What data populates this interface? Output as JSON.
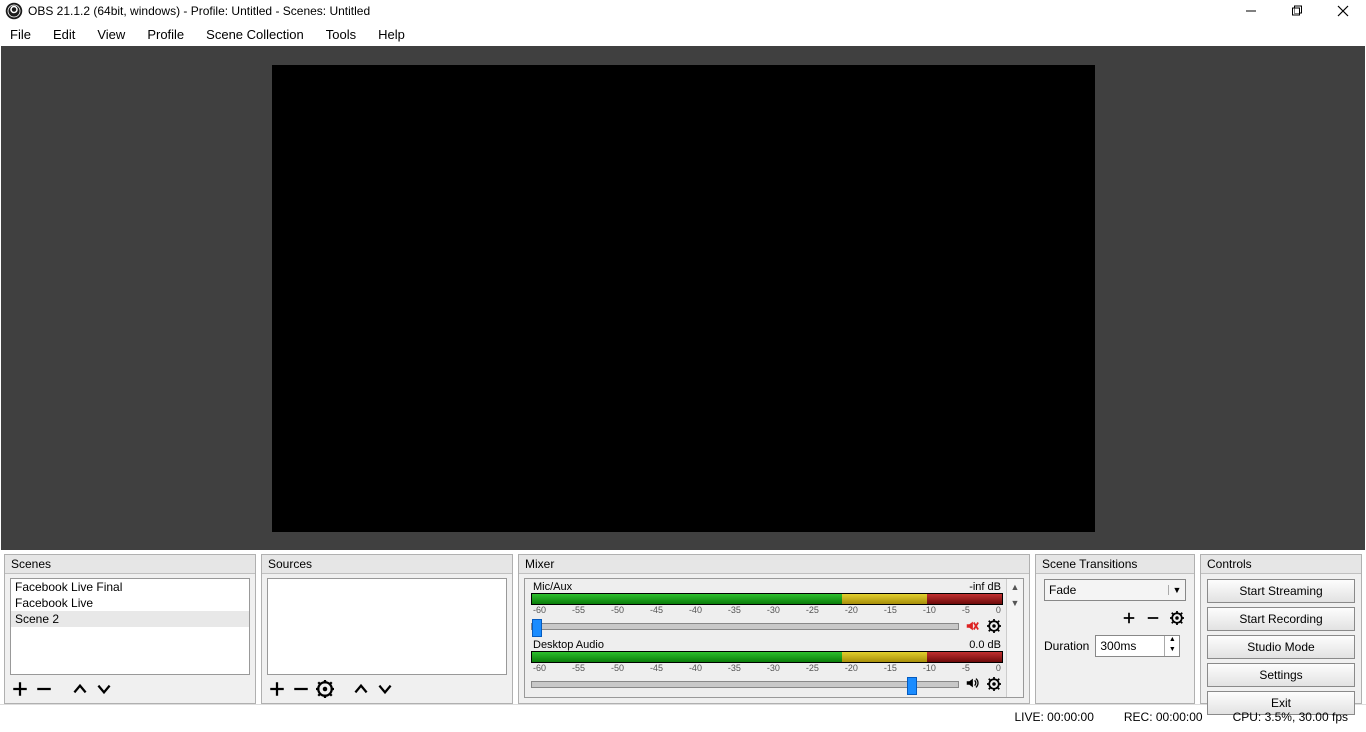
{
  "title": "OBS 21.1.2 (64bit, windows) - Profile: Untitled - Scenes: Untitled",
  "menu": [
    "File",
    "Edit",
    "View",
    "Profile",
    "Scene Collection",
    "Tools",
    "Help"
  ],
  "docks": {
    "scenes": {
      "title": "Scenes",
      "items": [
        "Facebook Live Final",
        "Facebook Live",
        "Scene 2"
      ],
      "selected": 2
    },
    "sources": {
      "title": "Sources"
    },
    "mixer": {
      "title": "Mixer",
      "channels": [
        {
          "name": "Mic/Aux",
          "level": "-inf dB",
          "muted": true,
          "slider": 0
        },
        {
          "name": "Desktop Audio",
          "level": "0.0 dB",
          "muted": false,
          "slider": 88
        }
      ],
      "ticks": [
        "-60",
        "-55",
        "-50",
        "-45",
        "-40",
        "-35",
        "-30",
        "-25",
        "-20",
        "-15",
        "-10",
        "-5",
        "0"
      ]
    },
    "transitions": {
      "title": "Scene Transitions",
      "selected": "Fade",
      "duration_label": "Duration",
      "duration": "300ms"
    },
    "controls": {
      "title": "Controls",
      "buttons": [
        "Start Streaming",
        "Start Recording",
        "Studio Mode",
        "Settings",
        "Exit"
      ]
    }
  },
  "status": {
    "live": "LIVE: 00:00:00",
    "rec": "REC: 00:00:00",
    "cpu": "CPU: 3.5%, 30.00 fps"
  }
}
